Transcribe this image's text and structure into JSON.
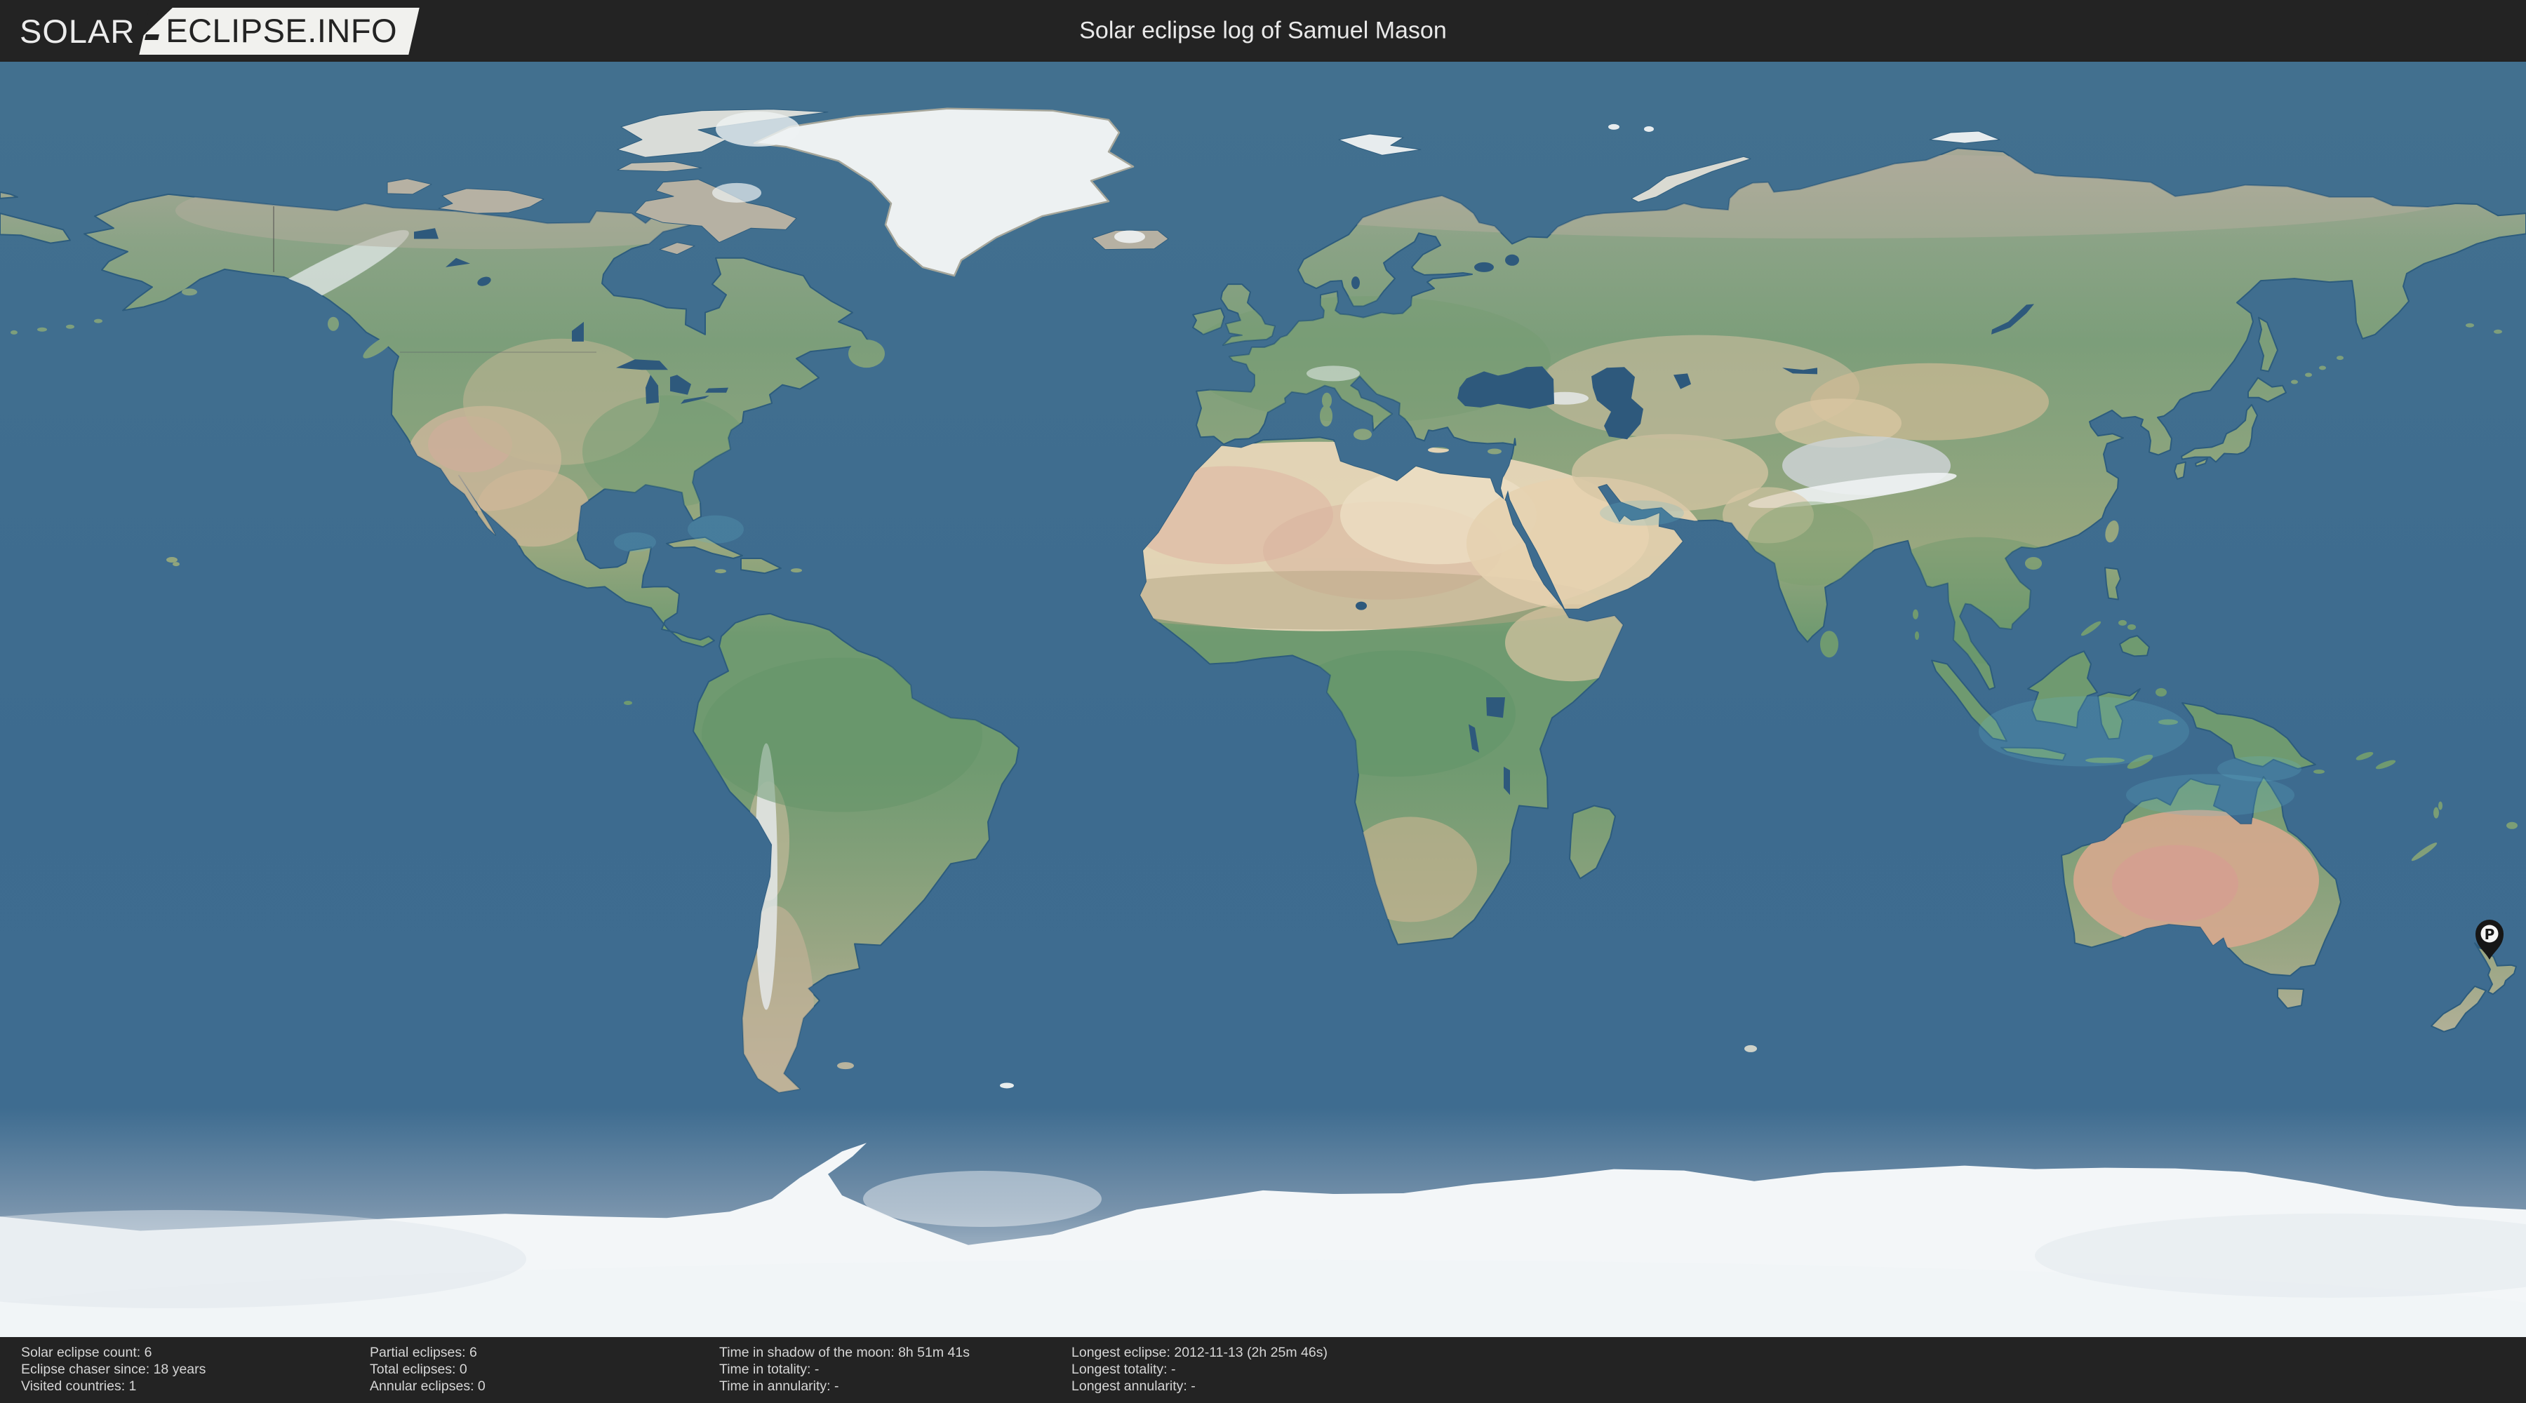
{
  "header": {
    "logo": {
      "word1": "SOLAR",
      "word2": "ECLIPSE.INFO"
    },
    "title": "Solar eclipse log of Samuel Mason"
  },
  "map": {
    "marker": {
      "label": "P"
    }
  },
  "footer": {
    "columns": [
      {
        "lines": [
          "Solar eclipse count: 6",
          "Eclipse chaser since: 18 years",
          "Visited countries: 1"
        ]
      },
      {
        "lines": [
          "Partial eclipses: 6",
          "Total eclipses: 0",
          "Annular eclipses: 0"
        ]
      },
      {
        "lines": [
          "Time in shadow of the moon: 8h 51m 41s",
          "Time in totality: -",
          "Time in annularity: -"
        ]
      },
      {
        "lines": [
          "Longest eclipse: 2012-11-13 (2h 25m 46s)",
          "Longest totality: -",
          "Longest annularity: -"
        ]
      }
    ]
  },
  "colors": {
    "header_bg": "#232323",
    "ocean": "#3d6b8f",
    "land_green": "#7d9c77",
    "desert_tan": "#e6d3b4",
    "ice_white": "#f2f5f7",
    "marker": "#161616"
  }
}
